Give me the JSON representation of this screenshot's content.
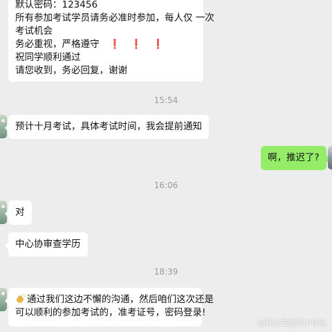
{
  "messages": {
    "top_block": {
      "lines": [
        "默认密码：123456",
        "所有参加考试学员请务必准时参加，每人仅 一次",
        "考试机会",
        "务必重视，严格遵守",
        "祝同学顺利通过",
        "请您收到，务必回复，谢谢"
      ],
      "warning_marks": [
        "❗",
        "❗",
        "❗"
      ]
    },
    "time_1": "15:54",
    "msg_notice": "预计十月考试，具体考试时间，我会提前通知",
    "msg_me": "啊，推迟了?",
    "time_2": "16:06",
    "msg_dui": "对",
    "msg_center": "中心协审查学历",
    "time_3": "18:39",
    "msg_last": {
      "line1": "通过我们这边不懈的沟通，然后咱们这次还是",
      "line2": "可以顺利的参加考试的，准考证号，密码登录!"
    }
  },
  "watermark": "@稀土掘金技术社区",
  "colors": {
    "background": "#ededed",
    "incoming_bubble": "#ffffff",
    "outgoing_bubble": "#95ec69",
    "timestamp": "#9a9a9a",
    "warning": "#e0261b"
  },
  "icons": {
    "warning": "exclamation-mark",
    "clap": "clapping-hands-emoji"
  }
}
